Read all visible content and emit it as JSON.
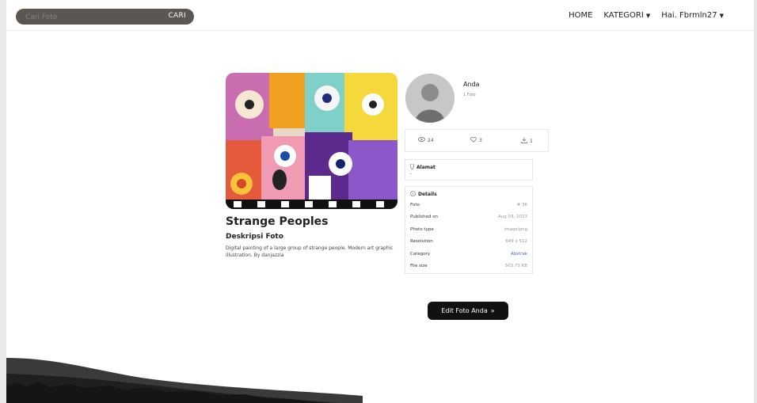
{
  "search": {
    "placeholder": "Cari Foto",
    "button_label": "CARI"
  },
  "nav": {
    "home": "HOME",
    "category": "KATEGORI",
    "user": "Hai. Fbrmln27"
  },
  "photo": {
    "title": "Strange Peoples",
    "description_label": "Deskripsi Foto",
    "description": "Digital painting of a large group of strange people. Modern art graphic illustration. By danjazzia"
  },
  "author": {
    "name": "Anda",
    "photo_count": "1 Foto"
  },
  "stats": {
    "views": "24",
    "likes": "3",
    "downloads": "1"
  },
  "address": {
    "label": "Alamat",
    "value": "-"
  },
  "details": {
    "label": "Details",
    "rows": [
      {
        "key": "Foto",
        "value": "# 36"
      },
      {
        "key": "Published on",
        "value": "Aug 03, 2023"
      },
      {
        "key": "Photo type",
        "value": "image/png"
      },
      {
        "key": "Resolution",
        "value": "649 x 512"
      },
      {
        "key": "Category",
        "value": "Abstrak"
      },
      {
        "key": "File size",
        "value": "503.73 KB"
      }
    ]
  },
  "edit_button": {
    "label": "Edit Foto Anda",
    "arrow": "»"
  },
  "colors": {
    "search_bg": "#5c5651",
    "button_bg": "#111111",
    "link": "#4a5be0"
  },
  "icons": [
    "eye-icon",
    "heart-icon",
    "download-icon",
    "location-pin-icon",
    "info-icon",
    "chevron-down-icon"
  ]
}
